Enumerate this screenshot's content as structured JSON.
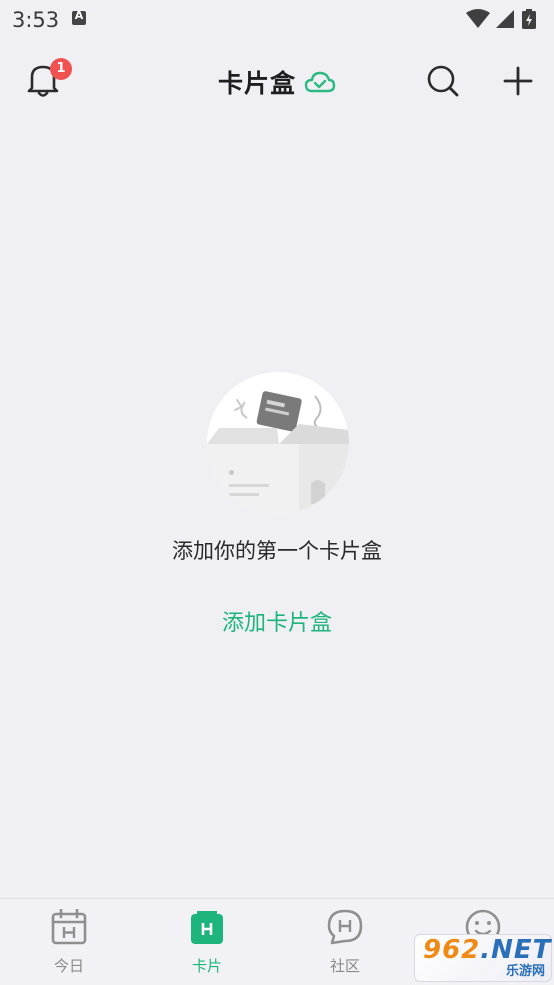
{
  "status_bar": {
    "time": "3:53",
    "notification_letter": "A"
  },
  "header": {
    "title": "卡片盒",
    "notification_count": "1",
    "icons": {
      "bell": "bell-icon",
      "cloud": "cloud-check-icon",
      "search": "search-icon",
      "add": "plus-icon"
    }
  },
  "empty_state": {
    "message": "添加你的第一个卡片盒",
    "action_label": "添加卡片盒"
  },
  "tabs": [
    {
      "label": "今日",
      "icon": "calendar-icon",
      "active": false
    },
    {
      "label": "卡片",
      "icon": "card-box-icon",
      "active": true
    },
    {
      "label": "社区",
      "icon": "chat-bubble-icon",
      "active": false
    },
    {
      "label": "",
      "icon": "smiley-icon",
      "active": false
    }
  ],
  "watermark": {
    "text_main": "962",
    "text_suffix": ".NET",
    "text_sub": "乐游网"
  },
  "colors": {
    "accent": "#1db57c",
    "badge": "#f05252",
    "background": "#efeff4"
  }
}
